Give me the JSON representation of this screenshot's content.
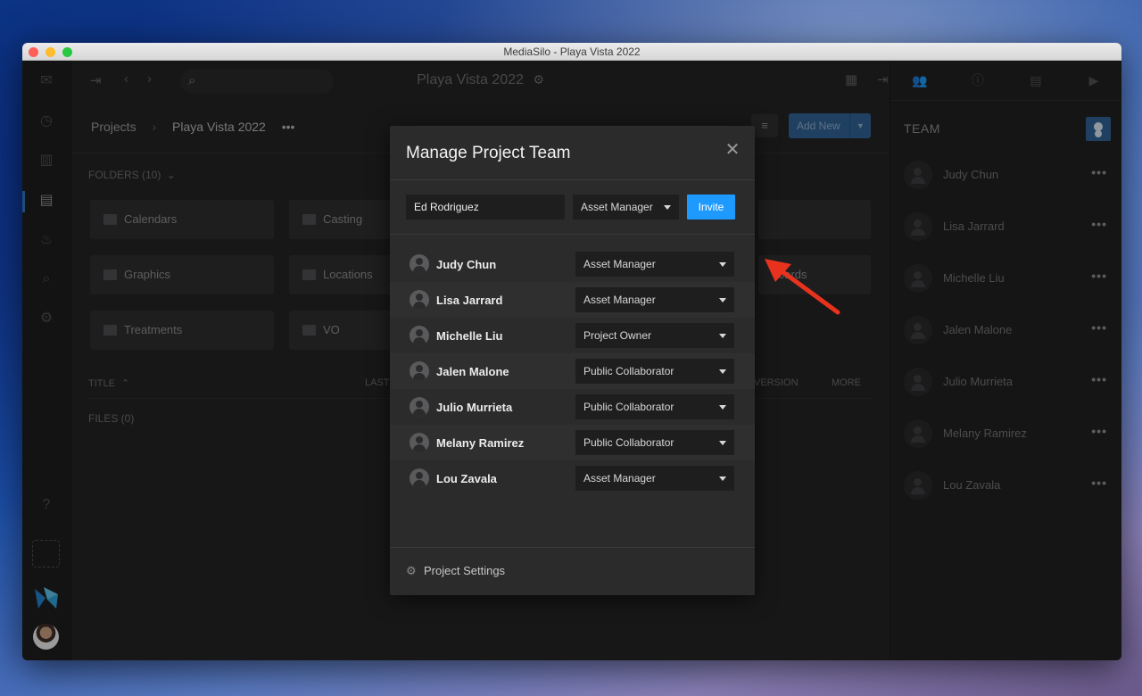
{
  "window": {
    "title": "MediaSilo - Playa Vista 2022"
  },
  "topbar": {
    "project_title": "Playa Vista 2022"
  },
  "breadcrumb": {
    "root": "Projects",
    "current": "Playa Vista 2022",
    "more": "•••"
  },
  "actions": {
    "add_new_label": "Add New"
  },
  "folders": {
    "header": "FOLDERS (10)",
    "items": [
      {
        "label": "Calendars"
      },
      {
        "label": "Casting"
      },
      {
        "label": "Graphics"
      },
      {
        "label": "Locations"
      },
      {
        "label": "oards"
      },
      {
        "label": "Treatments"
      },
      {
        "label": "VO"
      }
    ]
  },
  "files_table": {
    "columns": {
      "title": "TITLE",
      "last": "LAST",
      "version": "VERSION",
      "more": "MORE"
    },
    "files_header": "FILES (0)"
  },
  "right_panel": {
    "team_label": "TEAM",
    "members": [
      {
        "name": "Judy Chun"
      },
      {
        "name": "Lisa Jarrard"
      },
      {
        "name": "Michelle Liu"
      },
      {
        "name": "Jalen Malone"
      },
      {
        "name": "Julio Murrieta"
      },
      {
        "name": "Melany Ramirez"
      },
      {
        "name": "Lou Zavala"
      }
    ],
    "more_glyph": "•••"
  },
  "modal": {
    "title": "Manage Project Team",
    "invite_value": "Ed Rodriguez",
    "invite_role": "Asset Manager",
    "invite_button": "Invite",
    "members": [
      {
        "name": "Judy Chun",
        "role": "Asset Manager"
      },
      {
        "name": "Lisa Jarrard",
        "role": "Asset Manager"
      },
      {
        "name": "Michelle Liu",
        "role": "Project Owner"
      },
      {
        "name": "Jalen Malone",
        "role": "Public Collaborator"
      },
      {
        "name": "Julio Murrieta",
        "role": "Public Collaborator"
      },
      {
        "name": "Melany Ramirez",
        "role": "Public Collaborator"
      },
      {
        "name": "Lou Zavala",
        "role": "Asset Manager"
      }
    ],
    "footer_label": "Project Settings"
  },
  "colors": {
    "accent": "#1e9aff",
    "annotation_arrow": "#e8321e"
  }
}
